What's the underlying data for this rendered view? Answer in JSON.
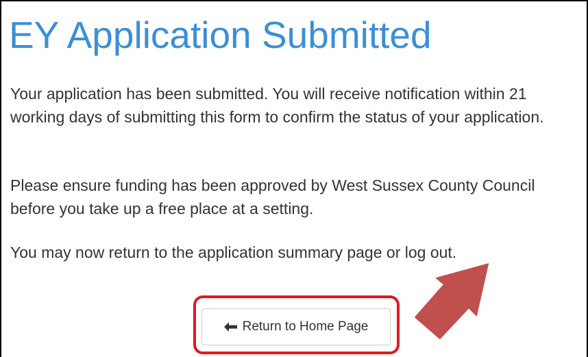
{
  "page": {
    "title": "EY Application Submitted",
    "paragraphs": [
      "Your application has been submitted. You will receive notification within 21 working days of submitting this form to confirm the status of your application.",
      "Please ensure funding has been approved by West Sussex County Council before you take up a free place at a setting.",
      "You may now return to the application summary page or log out."
    ]
  },
  "actions": {
    "home_button_label": "Return to Home Page",
    "home_button_icon": "arrow-left-icon"
  },
  "annotations": {
    "highlight_color": "#e0191f",
    "pointer_arrow_color": "#c0504d"
  },
  "colors": {
    "title": "#3b8fd4",
    "body_text": "#333333",
    "frame_border": "#000000"
  }
}
